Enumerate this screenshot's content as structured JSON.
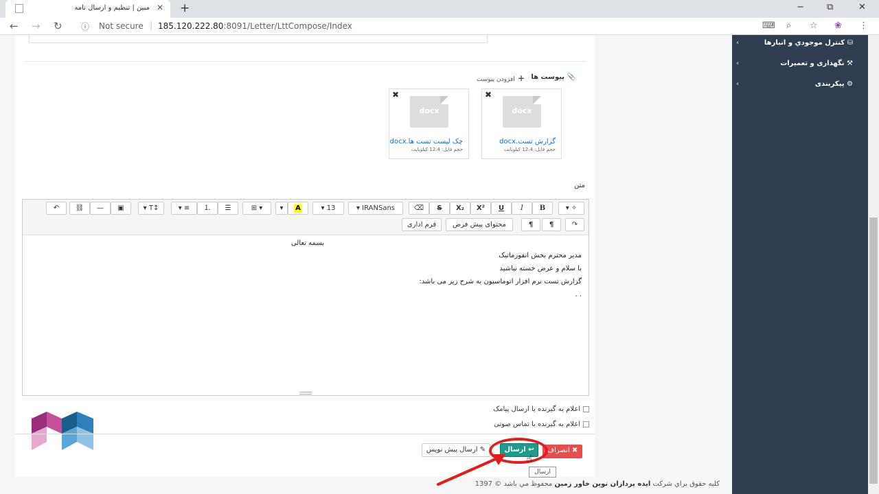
{
  "browser": {
    "tab_title": "مبین | تنظیم و ارسال نامه",
    "new_tab": "+",
    "close_tab": "✕",
    "not_secure": "Not secure",
    "url_host": "185.120.222.80",
    "url_path": ":8091/Letter/LttCompose/Index",
    "window_buttons": {
      "minimize": "−",
      "maximize": "⧉",
      "close": "✕"
    }
  },
  "sidebar": {
    "items": [
      {
        "label": "کنترل موجودي و انبارها",
        "icon": "boxes-icon"
      },
      {
        "label": "نگهداری و تعمیرات",
        "icon": "wrench-icon"
      },
      {
        "label": "پیکربندی",
        "icon": "cogs-icon"
      }
    ]
  },
  "attachments": {
    "title": "پیوست ها",
    "add_label": "افزودن پیوست",
    "files": [
      {
        "name": "گزارش تست.docx",
        "size": "حجم فایل: 12.4 کیلوبایت",
        "ext": "docx"
      },
      {
        "name": "چک لیست تست ها.docx",
        "size": "حجم فایل: 12.4 کیلوبایت",
        "ext": "docx"
      }
    ]
  },
  "body_label": "متن",
  "editor": {
    "font_name": "IRANSans",
    "font_size": "13",
    "default_content_label": "محتوای پیش فرض",
    "admin_form_label": "فرم اداری",
    "lines": [
      "بسمه تعالی",
      "مدیر محترم بخش انفورماتیک",
      "با سلام و عرض خسته نباشید",
      "گزارش تست نرم افزار اتوماسیون به شرح زیر می باشد:",
      ". ."
    ]
  },
  "options": {
    "sms": "اعلام به گیرنده با ارسال پیامک",
    "voice": "اعلام به گیرنده با تماس صوتی"
  },
  "actions": {
    "cancel": "انصراف",
    "send": "ارسال",
    "draft": "ارسال پیش نویس",
    "tooltip": "ارسال"
  },
  "footer": {
    "prefix": "کلیه حقوق براي شرکت",
    "company": "ایده پردازان نوین خاور زمین",
    "suffix": "محفوظ مي باشد © 1397"
  },
  "colors": {
    "sidebar_bg": "#2e3e50",
    "send_btn": "#1f9b8d",
    "cancel_btn": "#e84c4c",
    "highlight_ring": "#e11d1d"
  }
}
